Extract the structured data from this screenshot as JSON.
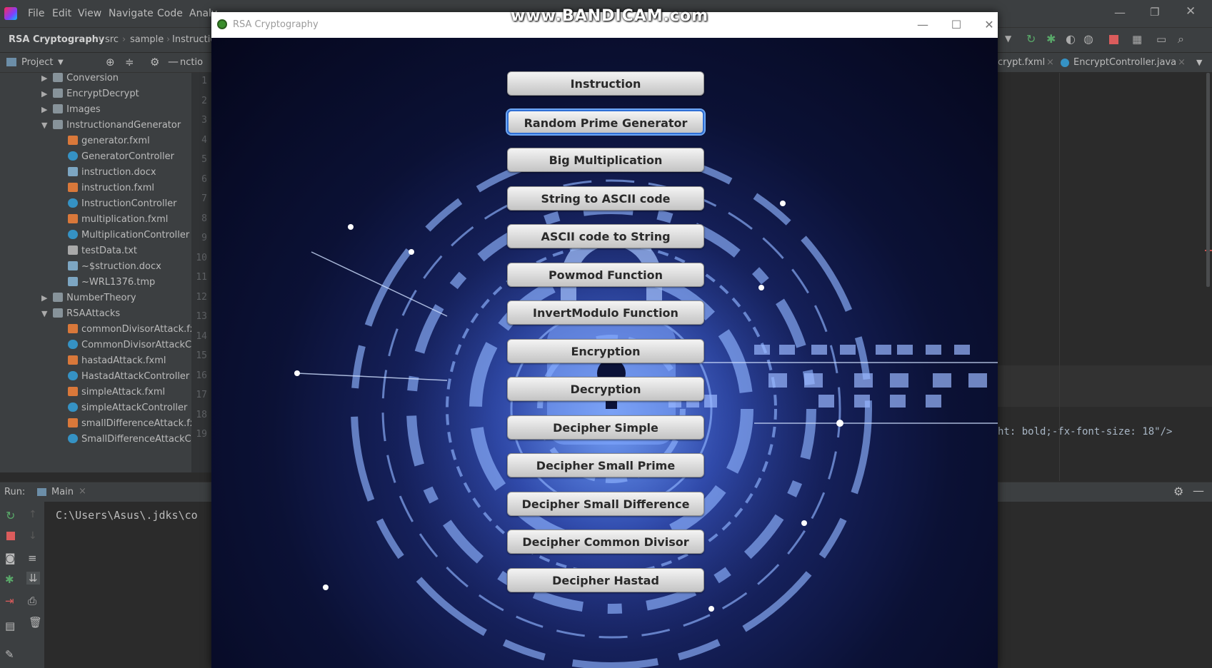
{
  "ide": {
    "menu": [
      "File",
      "Edit",
      "View",
      "Navigate",
      "Code",
      "Analy"
    ],
    "breadcrumbs": [
      "RSA Cryptography",
      "src",
      "sample",
      "Instructio"
    ],
    "project_label": "Project",
    "editor_tabs": [
      "crypt.fxml",
      "EncryptController.java"
    ],
    "code_line": "ht: bold;-fx-font-size: 18\"/>",
    "tree_partial_label": "nctio",
    "tree": [
      {
        "label": "Conversion",
        "type": "folder",
        "depth": 1,
        "expanded": false
      },
      {
        "label": "EncryptDecrypt",
        "type": "folder",
        "depth": 1,
        "expanded": false
      },
      {
        "label": "Images",
        "type": "folder",
        "depth": 1,
        "expanded": false
      },
      {
        "label": "InstructionandGenerator",
        "type": "folder",
        "depth": 1,
        "expanded": true
      },
      {
        "label": "generator.fxml",
        "type": "fxml",
        "depth": 2
      },
      {
        "label": "GeneratorController",
        "type": "java",
        "depth": 2
      },
      {
        "label": "instruction.docx",
        "type": "doc",
        "depth": 2
      },
      {
        "label": "instruction.fxml",
        "type": "fxml",
        "depth": 2
      },
      {
        "label": "InstructionController",
        "type": "java",
        "depth": 2
      },
      {
        "label": "multiplication.fxml",
        "type": "fxml",
        "depth": 2
      },
      {
        "label": "MultiplicationController",
        "type": "java",
        "depth": 2
      },
      {
        "label": "testData.txt",
        "type": "txt",
        "depth": 2
      },
      {
        "label": "~$struction.docx",
        "type": "doc",
        "depth": 2
      },
      {
        "label": "~WRL1376.tmp",
        "type": "doc",
        "depth": 2
      },
      {
        "label": "NumberTheory",
        "type": "folder",
        "depth": 1,
        "expanded": false
      },
      {
        "label": "RSAAttacks",
        "type": "folder",
        "depth": 1,
        "expanded": true
      },
      {
        "label": "commonDivisorAttack.fx",
        "type": "fxml",
        "depth": 2
      },
      {
        "label": "CommonDivisorAttackC",
        "type": "java",
        "depth": 2
      },
      {
        "label": "hastadAttack.fxml",
        "type": "fxml",
        "depth": 2
      },
      {
        "label": "HastadAttackController",
        "type": "java",
        "depth": 2
      },
      {
        "label": "simpleAttack.fxml",
        "type": "fxml",
        "depth": 2
      },
      {
        "label": "simpleAttackController",
        "type": "java",
        "depth": 2
      },
      {
        "label": "smallDifferenceAttack.fx",
        "type": "fxml",
        "depth": 2
      },
      {
        "label": "SmallDifferenceAttackC",
        "type": "java",
        "depth": 2
      }
    ],
    "line_numbers": [
      "1",
      "2",
      "3",
      "4",
      "5",
      "6",
      "7",
      "8",
      "9",
      "10",
      "11",
      "12",
      "13",
      "14",
      "15",
      "16",
      "17",
      "18",
      "19"
    ],
    "run": {
      "label": "Run:",
      "config": "Main",
      "console_text": "C:\\Users\\Asus\\.jdks\\co"
    }
  },
  "watermark": "www.BANDICAM.com",
  "app": {
    "title": "RSA Cryptography",
    "buttons": [
      "Instruction",
      "Random Prime Generator",
      "Big Multiplication",
      "String to ASCII code",
      "ASCII code to String",
      "Powmod Function",
      "InvertModulo Function",
      "Encryption",
      "Decryption",
      "Decipher Simple",
      "Decipher Small Prime",
      "Decipher Small Difference",
      "Decipher Common Divisor",
      "Decipher Hastad"
    ],
    "focused_index": 1
  },
  "colors": {
    "ide_bg": "#2b2b2b",
    "ide_panel": "#3c3f41",
    "button_focus": "#2f6fd6",
    "app_bg_center": "#4f7ae0"
  }
}
